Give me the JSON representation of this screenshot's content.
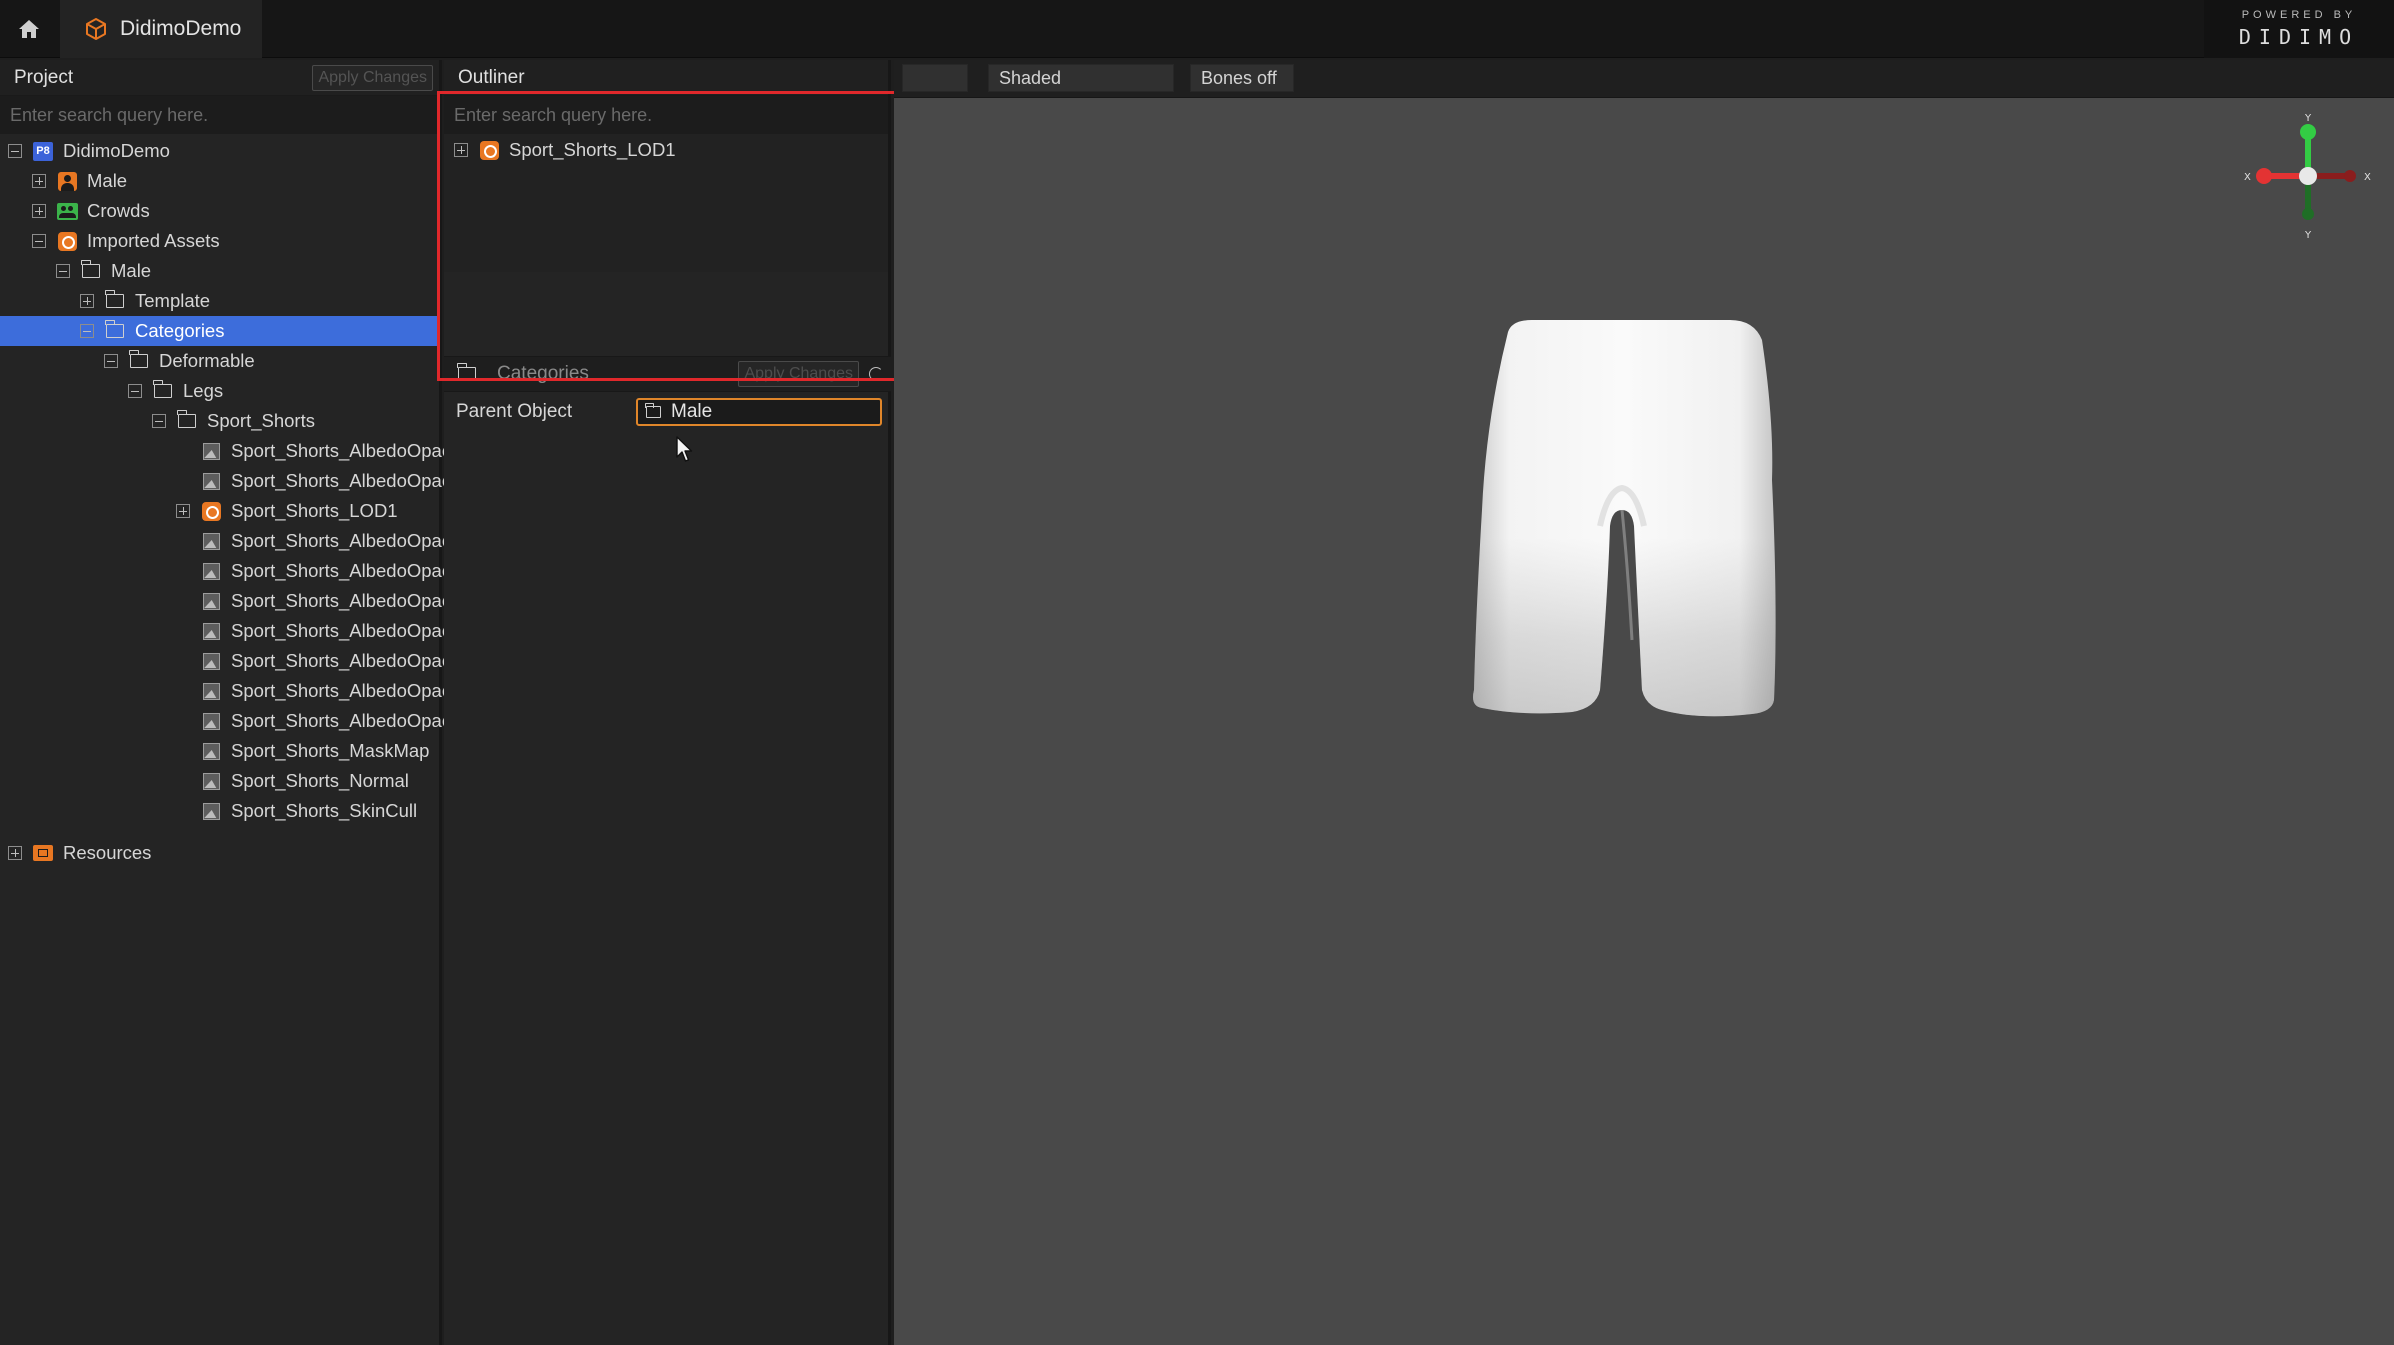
{
  "app": {
    "tab_title": "DidimoDemo",
    "powered_by": "POWERED BY",
    "brand_logo": "DIDIMO"
  },
  "project_panel": {
    "title": "Project",
    "apply_label": "Apply Changes",
    "search_placeholder": "Enter search query here.",
    "tree": [
      {
        "label": "DidimoDemo",
        "icon": "project-icon",
        "expander": "minus",
        "selected": false
      },
      {
        "label": "Male",
        "icon": "person-icon",
        "expander": "plus",
        "selected": false
      },
      {
        "label": "Crowds",
        "icon": "crowds-icon",
        "expander": "plus",
        "selected": false
      },
      {
        "label": "Imported Assets",
        "icon": "model-icon",
        "expander": "minus",
        "selected": false
      },
      {
        "label": "Male",
        "icon": "folder-icon",
        "expander": "minus",
        "selected": false
      },
      {
        "label": "Template",
        "icon": "folder-icon",
        "expander": "plus",
        "selected": false
      },
      {
        "label": "Categories",
        "icon": "folder-icon",
        "expander": "minus",
        "selected": true
      },
      {
        "label": "Deformable",
        "icon": "folder-icon",
        "expander": "minus",
        "selected": false
      },
      {
        "label": "Legs",
        "icon": "folder-icon",
        "expander": "minus",
        "selected": false
      },
      {
        "label": "Sport_Shorts",
        "icon": "folder-icon",
        "expander": "minus",
        "selected": false
      },
      {
        "label": "Sport_Shorts_AlbedoOpac",
        "icon": "texture-icon",
        "expander": "none",
        "selected": false
      },
      {
        "label": "Sport_Shorts_AlbedoOpac",
        "icon": "texture-icon",
        "expander": "none",
        "selected": false
      },
      {
        "label": "Sport_Shorts_LOD1",
        "icon": "model-icon",
        "expander": "plus",
        "selected": false
      },
      {
        "label": "Sport_Shorts_AlbedoOpac",
        "icon": "texture-icon",
        "expander": "none",
        "selected": false
      },
      {
        "label": "Sport_Shorts_AlbedoOpac",
        "icon": "texture-icon",
        "expander": "none",
        "selected": false
      },
      {
        "label": "Sport_Shorts_AlbedoOpac",
        "icon": "texture-icon",
        "expander": "none",
        "selected": false
      },
      {
        "label": "Sport_Shorts_AlbedoOpac",
        "icon": "texture-icon",
        "expander": "none",
        "selected": false
      },
      {
        "label": "Sport_Shorts_AlbedoOpac",
        "icon": "texture-icon",
        "expander": "none",
        "selected": false
      },
      {
        "label": "Sport_Shorts_AlbedoOpac",
        "icon": "texture-icon",
        "expander": "none",
        "selected": false
      },
      {
        "label": "Sport_Shorts_AlbedoOpac",
        "icon": "texture-icon",
        "expander": "none",
        "selected": false
      },
      {
        "label": "Sport_Shorts_MaskMap",
        "icon": "texture-icon",
        "expander": "none",
        "selected": false
      },
      {
        "label": "Sport_Shorts_Normal",
        "icon": "texture-icon",
        "expander": "none",
        "selected": false
      },
      {
        "label": "Sport_Shorts_SkinCull",
        "icon": "texture-icon",
        "expander": "none",
        "selected": false
      },
      {
        "label": "Resources",
        "icon": "resources-icon",
        "expander": "plus",
        "selected": false
      }
    ]
  },
  "outliner": {
    "title": "Outliner",
    "search_placeholder": "Enter search query here.",
    "items": [
      {
        "label": "Sport_Shorts_LOD1",
        "icon": "model-icon",
        "expander": "plus"
      }
    ]
  },
  "inspector": {
    "title": "Categories",
    "apply_label": "Apply Changes",
    "parent_object_label": "Parent Object",
    "parent_object_value": "Male"
  },
  "viewport": {
    "first_button": "",
    "shading_mode": "Shaded",
    "bones_mode": "Bones off"
  },
  "colors": {
    "selection": "#3d6ddb",
    "accent_orange": "#e87722",
    "highlight_red": "#e0282b",
    "viewport_bg": "#494949"
  }
}
